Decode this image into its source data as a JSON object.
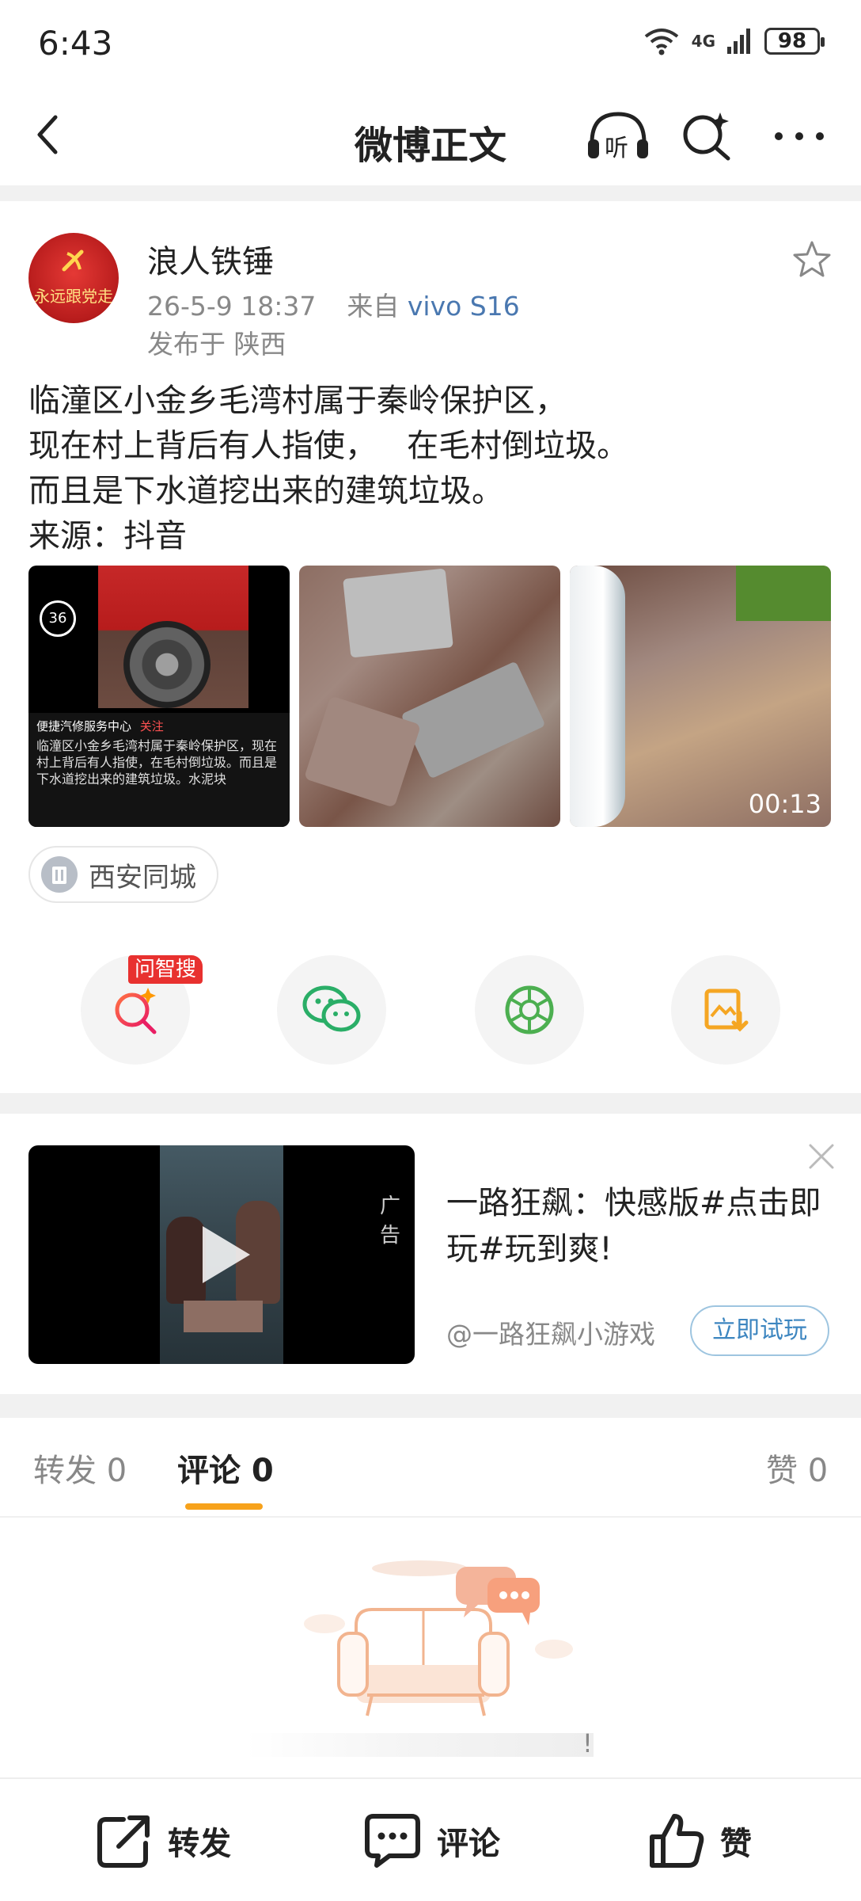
{
  "status": {
    "time": "6:43",
    "network": "4G",
    "battery": "98"
  },
  "nav": {
    "title": "微博正文",
    "listen_label": "听"
  },
  "post": {
    "author": "浪人铁锤",
    "avatar_text": "永远跟党走",
    "time": "26-5-9 18:37",
    "source_prefix": "来自",
    "source_device": "vivo S16",
    "location": "发布于 陕西",
    "text_lines": [
      "临潼区小金乡毛湾村属于秦岭保护区，",
      "现在村上背后有人指使，   在毛村倒垃圾。",
      "而且是下水道挖出来的建筑垃圾。",
      "来源：抖音"
    ],
    "thumb1": {
      "badge": "36",
      "channel": "便捷汽修服务中心",
      "follow": "关注",
      "caption": "临潼区小金乡毛湾村属于秦岭保护区，现在村上背后有人指使，在毛村倒垃圾。而且是下水道挖出来的建筑垃圾。水泥块"
    },
    "video_duration": "00:13",
    "location_chip": "西安同城"
  },
  "share": {
    "search_tag": "问智搜"
  },
  "ad": {
    "badge": "广告",
    "title": "一路狂飙：快感版#点击即玩#玩到爽!",
    "source": "@一路狂飙小游戏",
    "cta": "立即试玩"
  },
  "tabs": {
    "repost": "转发 0",
    "comment": "评论 0",
    "like": "赞 0"
  },
  "empty": {
    "text_tail": "!"
  },
  "bottom": {
    "repost": "转发",
    "comment": "评论",
    "like": "赞"
  },
  "colors": {
    "accent": "#f7a21b",
    "link_blue": "#4a78b0",
    "tag_red": "#e8312f"
  }
}
